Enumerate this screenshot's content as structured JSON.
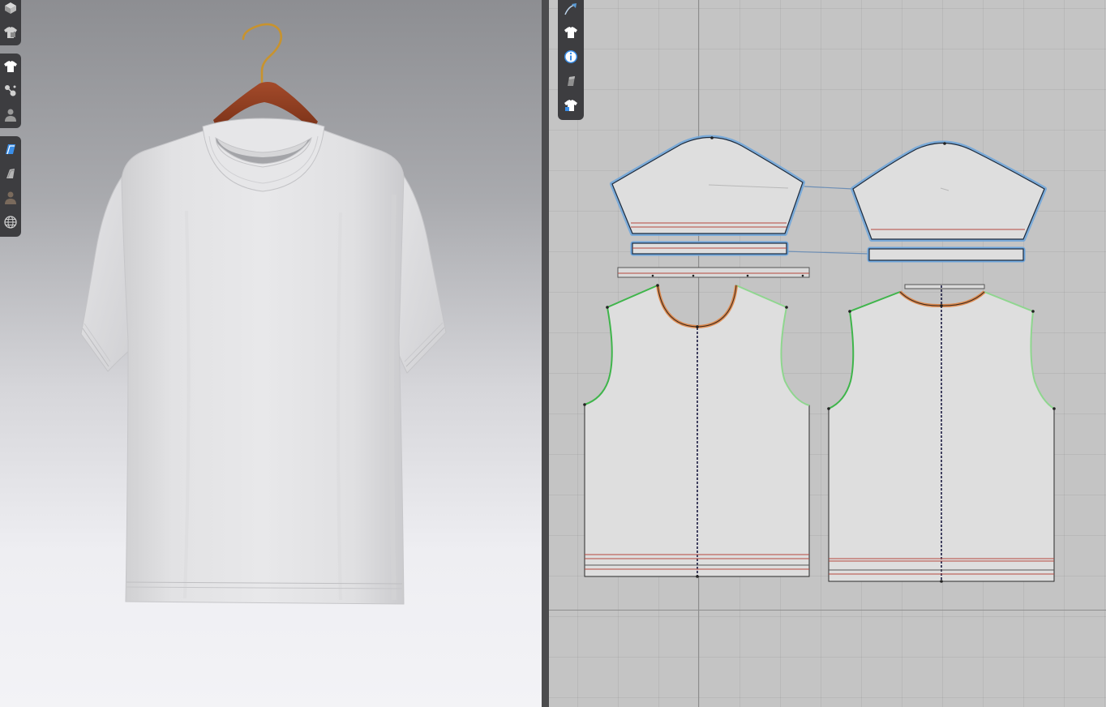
{
  "app": {
    "viewports": [
      "3d-garment-window",
      "2d-pattern-window"
    ]
  },
  "toolbar_3d": {
    "groups": [
      {
        "tools": [
          "simulation-icon",
          "garment-display-icon"
        ]
      },
      {
        "tools": [
          "tshirt-icon",
          "avatar-measure-icon",
          "avatar-icon"
        ]
      },
      {
        "tools": [
          "texture-icon",
          "hanger-icon",
          "avatar-pose-icon",
          "globe-icon"
        ]
      }
    ]
  },
  "toolbar_2d": {
    "tools": [
      "pen-tool-icon",
      "tshirt-icon",
      "info-icon",
      "eraser-icon",
      "locked-garment-icon"
    ]
  },
  "colors": {
    "toolbar_bg": "#3d3d40",
    "armhole_seam": "#3fb54b",
    "neckline_seam": "#e07f3a",
    "sleeve_selected": "#5b9bd5",
    "hem_line": "#c0392b",
    "grainline": "#1a1a40",
    "pattern_fill": "#dedede"
  }
}
